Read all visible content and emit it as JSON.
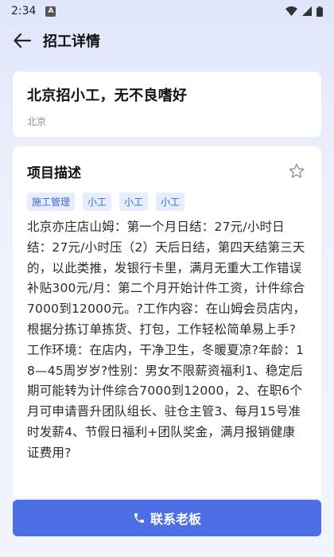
{
  "status": {
    "time": "2:34",
    "badge": "A"
  },
  "header": {
    "title": "招工详情"
  },
  "job": {
    "title": "北京招小工，无不良嗜好",
    "location": "北京"
  },
  "description": {
    "section_title": "项目描述",
    "tags": [
      "施工管理",
      "小工",
      "小工",
      "小工"
    ],
    "text": "北京亦庄店山姆：第一个月日结：27元/小时日结：27元/小时压（2）天后日结，第四天结第三天的，以此类推，发银行卡里，满月无重大工作错误补贴300元/月：第二个月开始计件工资，计件综合7000到12000元。?工作内容：在山姆会员店内，根据分拣订单拣货、打包，工作轻松简单易上手?工作环境：在店内，干净卫生，冬暖夏凉?年龄：18—45周岁岁?性别：男女不限薪资福利1、稳定后期可能转为计件综合7000到12000，2、在职6个月可申请晋升团队组长、驻仓主管3、每月15号准时发薪4、节假日福利+团队奖金，满月报销健康证费用?"
  },
  "footer": {
    "contact_label": "联系老板"
  },
  "colors": {
    "accent": "#4d6fe6",
    "tag_bg": "#e6edfd",
    "tag_text": "#3f66d8"
  }
}
